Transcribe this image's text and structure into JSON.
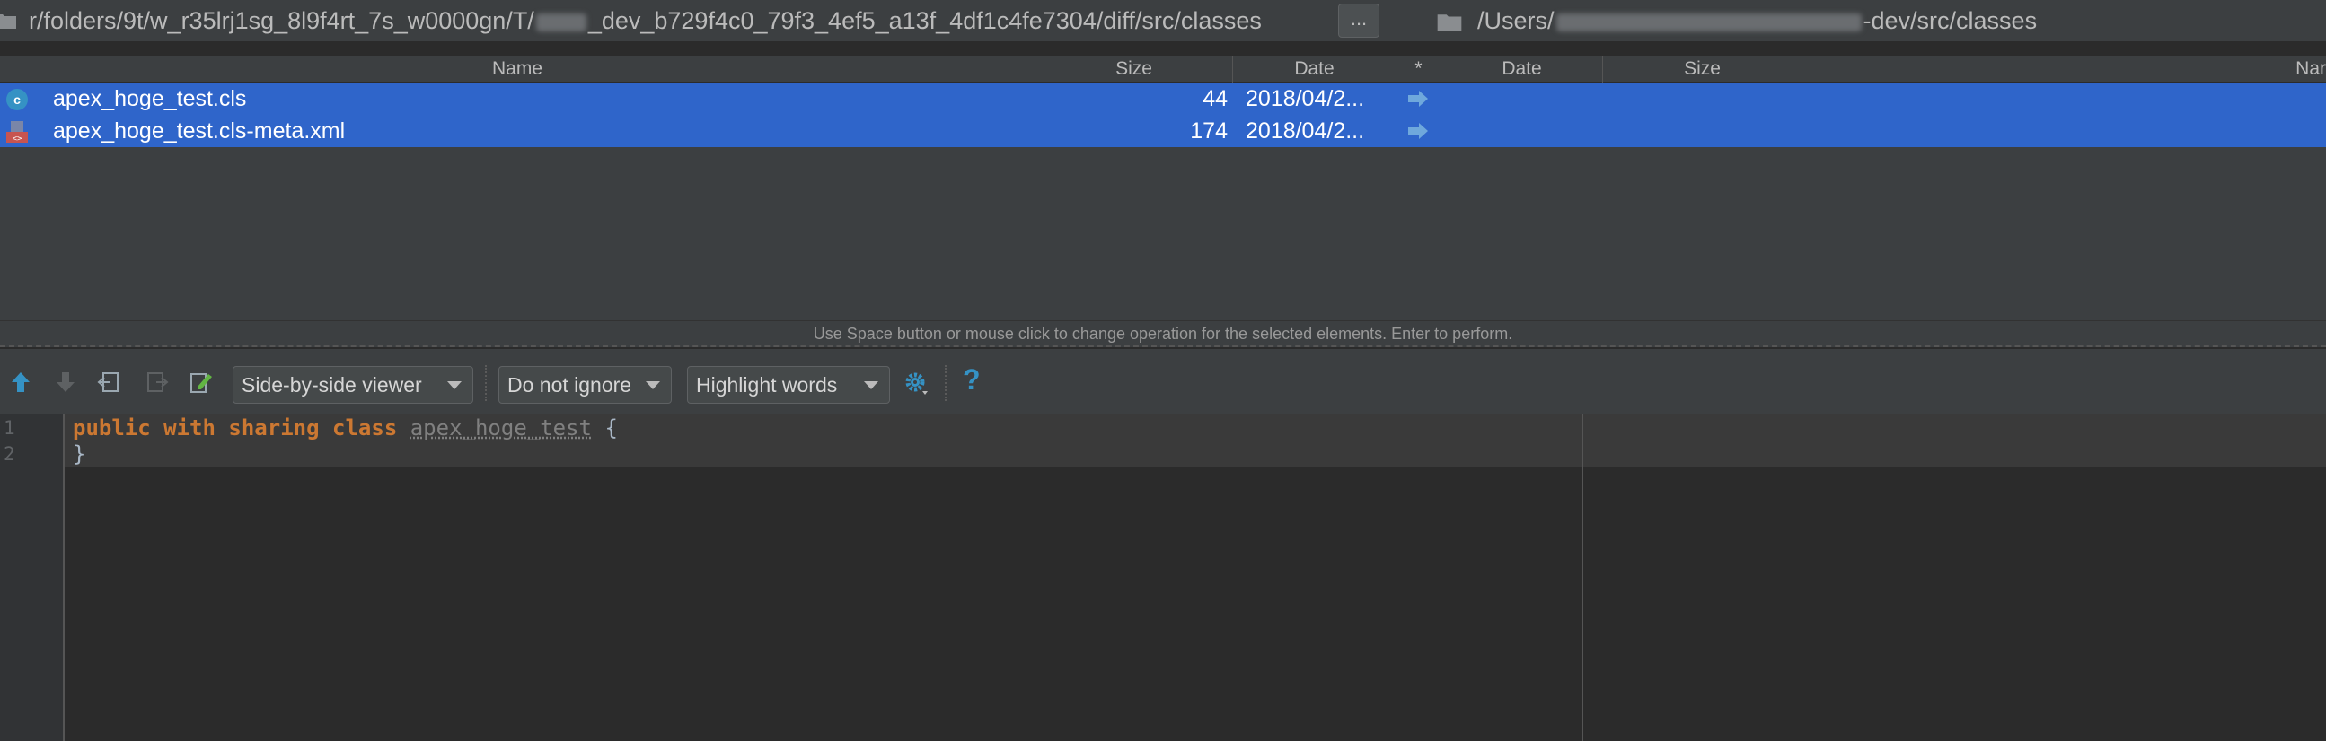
{
  "paths": {
    "left_prefix": "r/folders/9t/w_r35lrj1sg_8l9f4rt_7s_w0000gn/T/",
    "left_suffix": "_dev_b729f4c0_79f3_4ef5_a13f_4df1c4fe7304/diff/src/classes",
    "browse_label": "...",
    "right_prefix": "/Users/",
    "right_suffix": "-dev/src/classes"
  },
  "columns": {
    "name": "Name",
    "size": "Size",
    "date": "Date",
    "op": "*",
    "date_right": "Date",
    "size_right": "Size",
    "name_right": "Nar"
  },
  "rows": [
    {
      "name": "apex_hoge_test.cls",
      "size": "44",
      "date": "2018/04/2...",
      "icon": "apex-class-icon",
      "operation": "copy-right-arrow-icon"
    },
    {
      "name": "apex_hoge_test.cls-meta.xml",
      "size": "174",
      "date": "2018/04/2...",
      "icon": "xml-file-icon",
      "operation": "copy-right-arrow-icon"
    }
  ],
  "hint": "Use Space button or mouse click to change operation for the selected elements. Enter to perform.",
  "toolbar": {
    "viewer": "Side-by-side viewer",
    "ignore": "Do not ignore",
    "highlight": "Highlight words",
    "help": "?"
  },
  "editor": {
    "line_numbers": [
      "1",
      "2"
    ],
    "line1": {
      "kw1": "public",
      "kw2": "with",
      "kw3": "sharing",
      "kw4": "class",
      "name": "apex_hoge_test",
      "brace": "{"
    },
    "line2": "}"
  },
  "colors": {
    "selection": "#2f65ca",
    "panel": "#3c3f41",
    "editor_bg": "#2b2b2b",
    "keyword": "#cc7832",
    "accent_icon": "#3592c4"
  }
}
